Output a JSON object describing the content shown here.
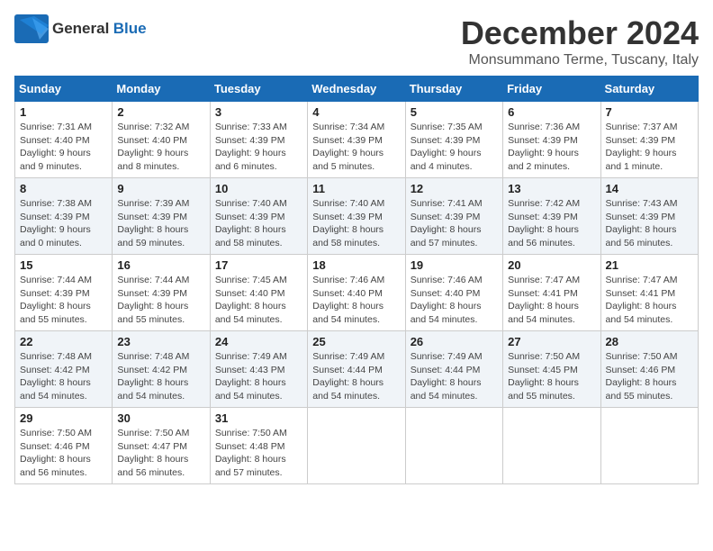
{
  "logo": {
    "general": "General",
    "blue": "Blue"
  },
  "title": {
    "month": "December 2024",
    "location": "Monsummano Terme, Tuscany, Italy"
  },
  "weekdays": [
    "Sunday",
    "Monday",
    "Tuesday",
    "Wednesday",
    "Thursday",
    "Friday",
    "Saturday"
  ],
  "weeks": [
    [
      {
        "day": "1",
        "sunrise": "7:31 AM",
        "sunset": "4:40 PM",
        "daylight": "9 hours and 9 minutes."
      },
      {
        "day": "2",
        "sunrise": "7:32 AM",
        "sunset": "4:40 PM",
        "daylight": "9 hours and 8 minutes."
      },
      {
        "day": "3",
        "sunrise": "7:33 AM",
        "sunset": "4:39 PM",
        "daylight": "9 hours and 6 minutes."
      },
      {
        "day": "4",
        "sunrise": "7:34 AM",
        "sunset": "4:39 PM",
        "daylight": "9 hours and 5 minutes."
      },
      {
        "day": "5",
        "sunrise": "7:35 AM",
        "sunset": "4:39 PM",
        "daylight": "9 hours and 4 minutes."
      },
      {
        "day": "6",
        "sunrise": "7:36 AM",
        "sunset": "4:39 PM",
        "daylight": "9 hours and 2 minutes."
      },
      {
        "day": "7",
        "sunrise": "7:37 AM",
        "sunset": "4:39 PM",
        "daylight": "9 hours and 1 minute."
      }
    ],
    [
      {
        "day": "8",
        "sunrise": "7:38 AM",
        "sunset": "4:39 PM",
        "daylight": "9 hours and 0 minutes."
      },
      {
        "day": "9",
        "sunrise": "7:39 AM",
        "sunset": "4:39 PM",
        "daylight": "8 hours and 59 minutes."
      },
      {
        "day": "10",
        "sunrise": "7:40 AM",
        "sunset": "4:39 PM",
        "daylight": "8 hours and 58 minutes."
      },
      {
        "day": "11",
        "sunrise": "7:40 AM",
        "sunset": "4:39 PM",
        "daylight": "8 hours and 58 minutes."
      },
      {
        "day": "12",
        "sunrise": "7:41 AM",
        "sunset": "4:39 PM",
        "daylight": "8 hours and 57 minutes."
      },
      {
        "day": "13",
        "sunrise": "7:42 AM",
        "sunset": "4:39 PM",
        "daylight": "8 hours and 56 minutes."
      },
      {
        "day": "14",
        "sunrise": "7:43 AM",
        "sunset": "4:39 PM",
        "daylight": "8 hours and 56 minutes."
      }
    ],
    [
      {
        "day": "15",
        "sunrise": "7:44 AM",
        "sunset": "4:39 PM",
        "daylight": "8 hours and 55 minutes."
      },
      {
        "day": "16",
        "sunrise": "7:44 AM",
        "sunset": "4:39 PM",
        "daylight": "8 hours and 55 minutes."
      },
      {
        "day": "17",
        "sunrise": "7:45 AM",
        "sunset": "4:40 PM",
        "daylight": "8 hours and 54 minutes."
      },
      {
        "day": "18",
        "sunrise": "7:46 AM",
        "sunset": "4:40 PM",
        "daylight": "8 hours and 54 minutes."
      },
      {
        "day": "19",
        "sunrise": "7:46 AM",
        "sunset": "4:40 PM",
        "daylight": "8 hours and 54 minutes."
      },
      {
        "day": "20",
        "sunrise": "7:47 AM",
        "sunset": "4:41 PM",
        "daylight": "8 hours and 54 minutes."
      },
      {
        "day": "21",
        "sunrise": "7:47 AM",
        "sunset": "4:41 PM",
        "daylight": "8 hours and 54 minutes."
      }
    ],
    [
      {
        "day": "22",
        "sunrise": "7:48 AM",
        "sunset": "4:42 PM",
        "daylight": "8 hours and 54 minutes."
      },
      {
        "day": "23",
        "sunrise": "7:48 AM",
        "sunset": "4:42 PM",
        "daylight": "8 hours and 54 minutes."
      },
      {
        "day": "24",
        "sunrise": "7:49 AM",
        "sunset": "4:43 PM",
        "daylight": "8 hours and 54 minutes."
      },
      {
        "day": "25",
        "sunrise": "7:49 AM",
        "sunset": "4:44 PM",
        "daylight": "8 hours and 54 minutes."
      },
      {
        "day": "26",
        "sunrise": "7:49 AM",
        "sunset": "4:44 PM",
        "daylight": "8 hours and 54 minutes."
      },
      {
        "day": "27",
        "sunrise": "7:50 AM",
        "sunset": "4:45 PM",
        "daylight": "8 hours and 55 minutes."
      },
      {
        "day": "28",
        "sunrise": "7:50 AM",
        "sunset": "4:46 PM",
        "daylight": "8 hours and 55 minutes."
      }
    ],
    [
      {
        "day": "29",
        "sunrise": "7:50 AM",
        "sunset": "4:46 PM",
        "daylight": "8 hours and 56 minutes."
      },
      {
        "day": "30",
        "sunrise": "7:50 AM",
        "sunset": "4:47 PM",
        "daylight": "8 hours and 56 minutes."
      },
      {
        "day": "31",
        "sunrise": "7:50 AM",
        "sunset": "4:48 PM",
        "daylight": "8 hours and 57 minutes."
      },
      null,
      null,
      null,
      null
    ]
  ],
  "labels": {
    "sunrise": "Sunrise:",
    "sunset": "Sunset:",
    "daylight": "Daylight:"
  }
}
